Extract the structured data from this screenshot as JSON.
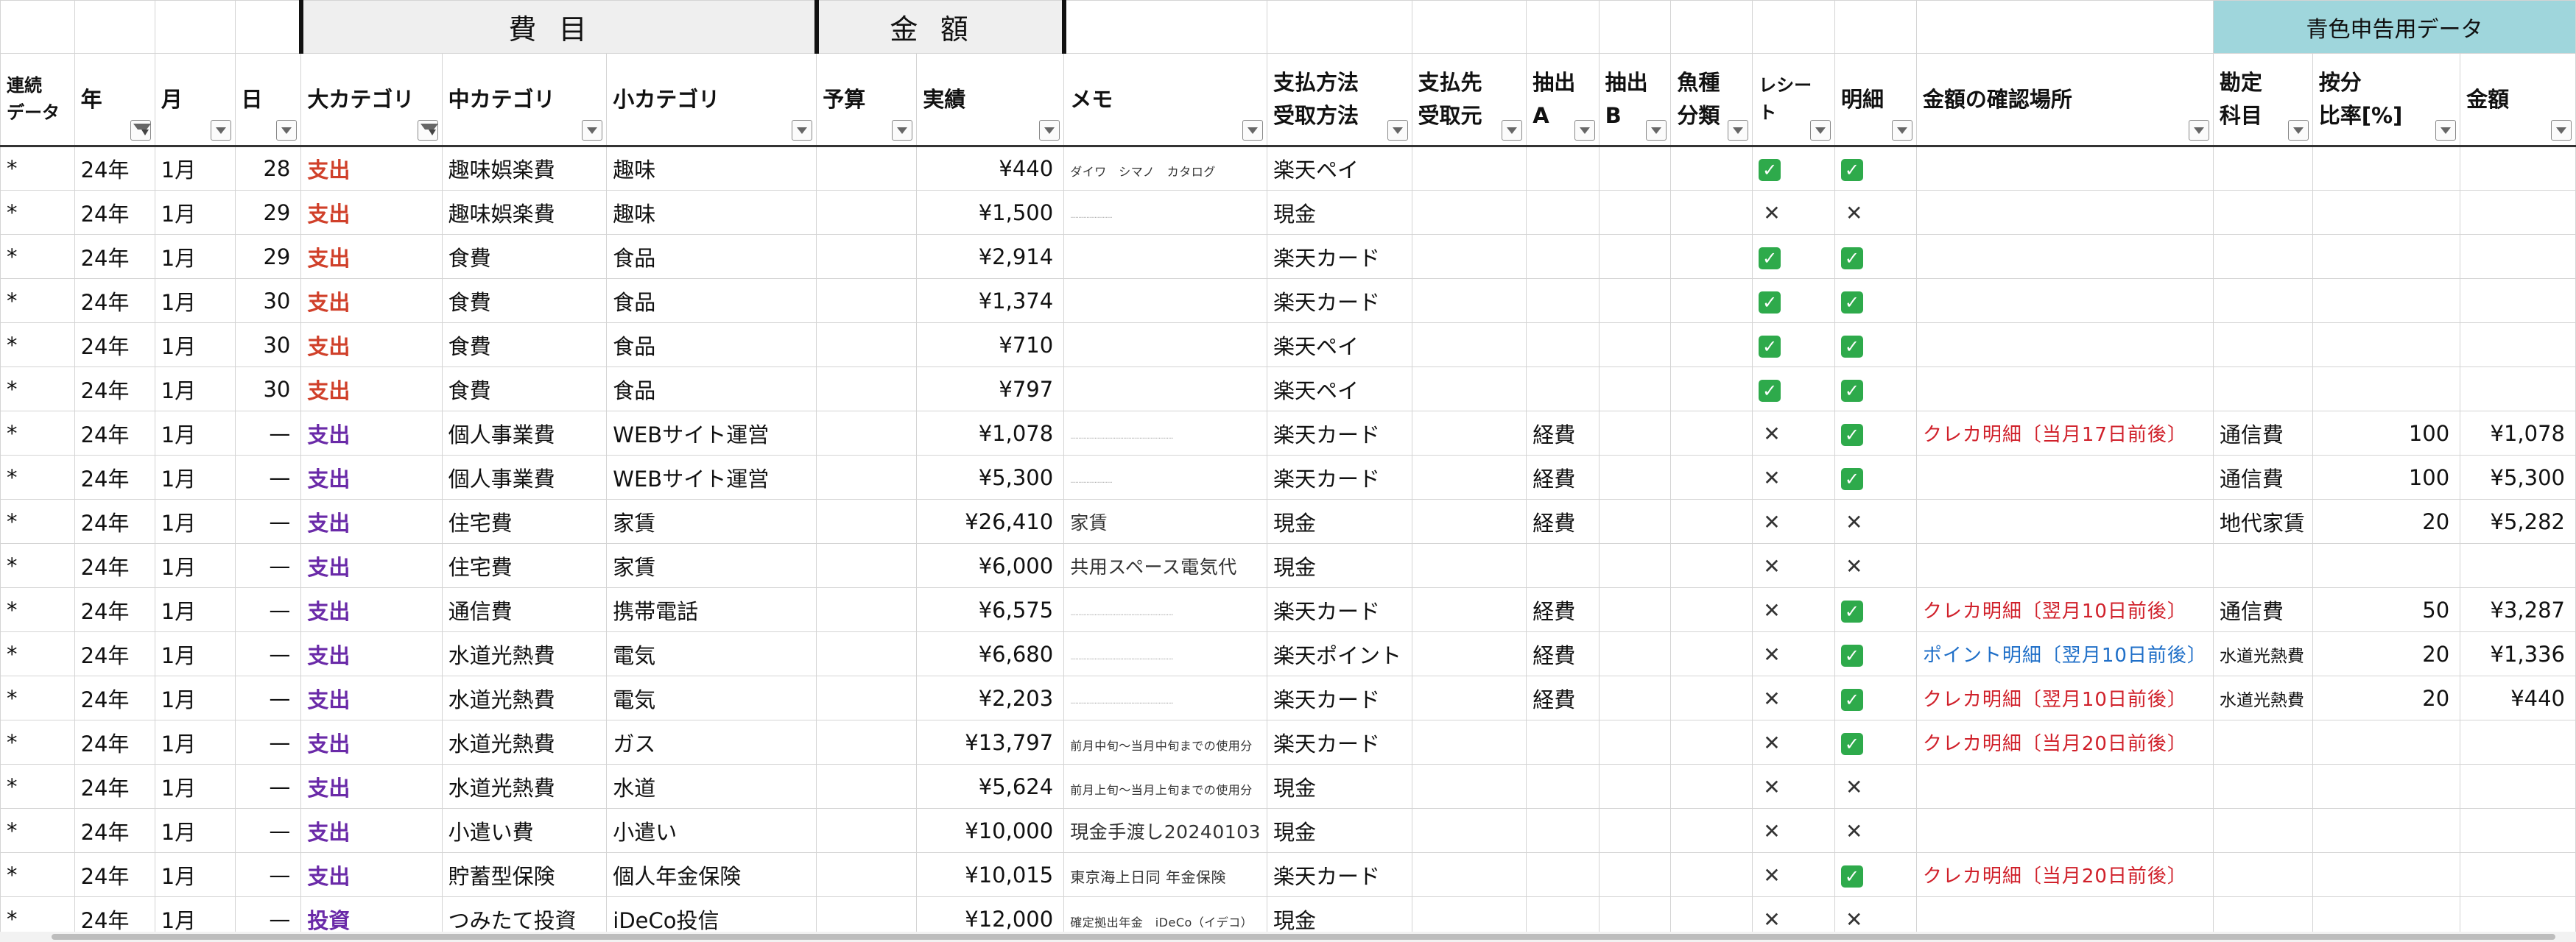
{
  "group_headers": {
    "cost_item": "費目",
    "amount": "金額",
    "blue_return": "青色申告用データ"
  },
  "columns": [
    {
      "label": "連続データ",
      "filter": false
    },
    {
      "label": "年",
      "filter": true,
      "active": true
    },
    {
      "label": "月",
      "filter": true
    },
    {
      "label": "日",
      "filter": true
    },
    {
      "label": "大カテゴリ",
      "filter": true,
      "active": true
    },
    {
      "label": "中カテゴリ",
      "filter": true
    },
    {
      "label": "小カテゴリ",
      "filter": true
    },
    {
      "label": "予算",
      "filter": true
    },
    {
      "label": "実績",
      "filter": true
    },
    {
      "label": "メモ",
      "filter": true
    },
    {
      "label": "支払方法受取方法",
      "filter": true
    },
    {
      "label": "支払先受取元",
      "filter": true
    },
    {
      "label": "抽出A",
      "filter": true
    },
    {
      "label": "抽出B",
      "filter": true
    },
    {
      "label": "魚種分類",
      "filter": true
    },
    {
      "label": "レシート",
      "filter": true
    },
    {
      "label": "明細",
      "filter": true
    },
    {
      "label": "金額の確認場所",
      "filter": true
    },
    {
      "label": "勘定科目",
      "filter": true
    },
    {
      "label": "按分比率[%]",
      "filter": true
    },
    {
      "label": "金額",
      "filter": true
    }
  ],
  "rows": [
    {
      "seq": "*",
      "year": "24年",
      "month": "1月",
      "day": "28",
      "major": "支出",
      "major_color": "red",
      "mid": "趣味娯楽費",
      "minor": "趣味",
      "budget": "",
      "actual": "¥440",
      "memo": "ダイワ　シマノ　カタログ",
      "memo_style": "small",
      "pay": "楽天ペイ",
      "payee": "",
      "ext_a": "",
      "ext_b": "",
      "fish": "",
      "receipt": "check",
      "detail": "check",
      "loc": "",
      "loc_color": "",
      "account": "",
      "ratio": "",
      "amount": ""
    },
    {
      "seq": "*",
      "year": "24年",
      "month": "1月",
      "day": "29",
      "major": "支出",
      "major_color": "red",
      "mid": "趣味娯楽費",
      "minor": "趣味",
      "budget": "",
      "actual": "¥1,500",
      "memo": "··························",
      "memo_style": "faint",
      "pay": "現金",
      "payee": "",
      "ext_a": "",
      "ext_b": "",
      "fish": "",
      "receipt": "cross",
      "detail": "cross",
      "loc": "",
      "loc_color": "",
      "account": "",
      "ratio": "",
      "amount": ""
    },
    {
      "seq": "*",
      "year": "24年",
      "month": "1月",
      "day": "29",
      "major": "支出",
      "major_color": "red",
      "mid": "食費",
      "minor": "食品",
      "budget": "",
      "actual": "¥2,914",
      "memo": "",
      "memo_style": "",
      "pay": "楽天カード",
      "payee": "",
      "ext_a": "",
      "ext_b": "",
      "fish": "",
      "receipt": "check",
      "detail": "check",
      "loc": "",
      "loc_color": "",
      "account": "",
      "ratio": "",
      "amount": ""
    },
    {
      "seq": "*",
      "year": "24年",
      "month": "1月",
      "day": "30",
      "major": "支出",
      "major_color": "red",
      "mid": "食費",
      "minor": "食品",
      "budget": "",
      "actual": "¥1,374",
      "memo": "",
      "memo_style": "",
      "pay": "楽天カード",
      "payee": "",
      "ext_a": "",
      "ext_b": "",
      "fish": "",
      "receipt": "check",
      "detail": "check",
      "loc": "",
      "loc_color": "",
      "account": "",
      "ratio": "",
      "amount": ""
    },
    {
      "seq": "*",
      "year": "24年",
      "month": "1月",
      "day": "30",
      "major": "支出",
      "major_color": "red",
      "mid": "食費",
      "minor": "食品",
      "budget": "",
      "actual": "¥710",
      "memo": "",
      "memo_style": "",
      "pay": "楽天ペイ",
      "payee": "",
      "ext_a": "",
      "ext_b": "",
      "fish": "",
      "receipt": "check",
      "detail": "check",
      "loc": "",
      "loc_color": "",
      "account": "",
      "ratio": "",
      "amount": ""
    },
    {
      "seq": "*",
      "year": "24年",
      "month": "1月",
      "day": "30",
      "major": "支出",
      "major_color": "red",
      "mid": "食費",
      "minor": "食品",
      "budget": "",
      "actual": "¥797",
      "memo": "",
      "memo_style": "",
      "pay": "楽天ペイ",
      "payee": "",
      "ext_a": "",
      "ext_b": "",
      "fish": "",
      "receipt": "check",
      "detail": "check",
      "loc": "",
      "loc_color": "",
      "account": "",
      "ratio": "",
      "amount": ""
    },
    {
      "seq": "*",
      "year": "24年",
      "month": "1月",
      "day": "—",
      "major": "支出",
      "major_color": "purple",
      "mid": "個人事業費",
      "minor": "WEBサイト運営",
      "budget": "",
      "actual": "¥1,078",
      "memo": "································································",
      "memo_style": "faint",
      "pay": "楽天カード",
      "payee": "",
      "ext_a": "経費",
      "ext_b": "",
      "fish": "",
      "receipt": "cross",
      "detail": "check",
      "loc": "クレカ明細〔当月17日前後〕",
      "loc_color": "red",
      "account": "通信費",
      "ratio": "100",
      "amount": "¥1,078"
    },
    {
      "seq": "*",
      "year": "24年",
      "month": "1月",
      "day": "—",
      "major": "支出",
      "major_color": "purple",
      "mid": "個人事業費",
      "minor": "WEBサイト運営",
      "budget": "",
      "actual": "¥5,300",
      "memo": "··························",
      "memo_style": "faint",
      "pay": "楽天カード",
      "payee": "",
      "ext_a": "経費",
      "ext_b": "",
      "fish": "",
      "receipt": "cross",
      "detail": "check",
      "loc": "",
      "loc_color": "",
      "account": "通信費",
      "ratio": "100",
      "amount": "¥5,300"
    },
    {
      "seq": "*",
      "year": "24年",
      "month": "1月",
      "day": "—",
      "major": "支出",
      "major_color": "purple",
      "mid": "住宅費",
      "minor": "家賃",
      "budget": "",
      "actual": "¥26,410",
      "memo": "家賃",
      "memo_style": "mid",
      "pay": "現金",
      "payee": "",
      "ext_a": "経費",
      "ext_b": "",
      "fish": "",
      "receipt": "cross",
      "detail": "cross",
      "loc": "",
      "loc_color": "",
      "account": "地代家賃",
      "ratio": "20",
      "amount": "¥5,282"
    },
    {
      "seq": "*",
      "year": "24年",
      "month": "1月",
      "day": "—",
      "major": "支出",
      "major_color": "purple",
      "mid": "住宅費",
      "minor": "家賃",
      "budget": "",
      "actual": "¥6,000",
      "memo": "共用スペース電気代",
      "memo_style": "mid",
      "pay": "現金",
      "payee": "",
      "ext_a": "",
      "ext_b": "",
      "fish": "",
      "receipt": "cross",
      "detail": "cross",
      "loc": "",
      "loc_color": "",
      "account": "",
      "ratio": "",
      "amount": ""
    },
    {
      "seq": "*",
      "year": "24年",
      "month": "1月",
      "day": "—",
      "major": "支出",
      "major_color": "purple",
      "mid": "通信費",
      "minor": "携帯電話",
      "budget": "",
      "actual": "¥6,575",
      "memo": "································································",
      "memo_style": "faint",
      "pay": "楽天カード",
      "payee": "",
      "ext_a": "経費",
      "ext_b": "",
      "fish": "",
      "receipt": "cross",
      "detail": "check",
      "loc": "クレカ明細〔翌月10日前後〕",
      "loc_color": "red",
      "account": "通信費",
      "ratio": "50",
      "amount": "¥3,287"
    },
    {
      "seq": "*",
      "year": "24年",
      "month": "1月",
      "day": "—",
      "major": "支出",
      "major_color": "purple",
      "mid": "水道光熱費",
      "minor": "電気",
      "budget": "",
      "actual": "¥6,680",
      "memo": "································································",
      "memo_style": "faint",
      "pay": "楽天ポイント",
      "payee": "",
      "ext_a": "経費",
      "ext_b": "",
      "fish": "",
      "receipt": "cross",
      "detail": "check",
      "loc": "ポイント明細〔翌月10日前後〕",
      "loc_color": "blue",
      "account": "水道光熱費",
      "ratio": "20",
      "amount": "¥1,336"
    },
    {
      "seq": "*",
      "year": "24年",
      "month": "1月",
      "day": "—",
      "major": "支出",
      "major_color": "purple",
      "mid": "水道光熱費",
      "minor": "電気",
      "budget": "",
      "actual": "¥2,203",
      "memo": "································································",
      "memo_style": "faint",
      "pay": "楽天カード",
      "payee": "",
      "ext_a": "経費",
      "ext_b": "",
      "fish": "",
      "receipt": "cross",
      "detail": "check",
      "loc": "クレカ明細〔翌月10日前後〕",
      "loc_color": "red",
      "account": "水道光熱費",
      "ratio": "20",
      "amount": "¥440"
    },
    {
      "seq": "*",
      "year": "24年",
      "month": "1月",
      "day": "—",
      "major": "支出",
      "major_color": "purple",
      "mid": "水道光熱費",
      "minor": "ガス",
      "budget": "",
      "actual": "¥13,797",
      "memo": "前月中旬～当月中旬までの使用分",
      "memo_style": "small",
      "pay": "楽天カード",
      "payee": "",
      "ext_a": "",
      "ext_b": "",
      "fish": "",
      "receipt": "cross",
      "detail": "check",
      "loc": "クレカ明細〔当月20日前後〕",
      "loc_color": "red",
      "account": "",
      "ratio": "",
      "amount": ""
    },
    {
      "seq": "*",
      "year": "24年",
      "month": "1月",
      "day": "—",
      "major": "支出",
      "major_color": "purple",
      "mid": "水道光熱費",
      "minor": "水道",
      "budget": "",
      "actual": "¥5,624",
      "memo": "前月上旬～当月上旬までの使用分",
      "memo_style": "small",
      "pay": "現金",
      "payee": "",
      "ext_a": "",
      "ext_b": "",
      "fish": "",
      "receipt": "cross",
      "detail": "cross",
      "loc": "",
      "loc_color": "",
      "account": "",
      "ratio": "",
      "amount": ""
    },
    {
      "seq": "*",
      "year": "24年",
      "month": "1月",
      "day": "—",
      "major": "支出",
      "major_color": "purple",
      "mid": "小遣い費",
      "minor": "小遣い",
      "budget": "",
      "actual": "¥10,000",
      "memo": "現金手渡し20240103",
      "memo_style": "mid",
      "pay": "現金",
      "payee": "",
      "ext_a": "",
      "ext_b": "",
      "fish": "",
      "receipt": "cross",
      "detail": "cross",
      "loc": "",
      "loc_color": "",
      "account": "",
      "ratio": "",
      "amount": ""
    },
    {
      "seq": "*",
      "year": "24年",
      "month": "1月",
      "day": "—",
      "major": "支出",
      "major_color": "purple",
      "mid": "貯蓄型保険",
      "minor": "個人年金保険",
      "budget": "",
      "actual": "¥10,015",
      "memo": "東京海上日同 年金保険",
      "memo_style": "smallmid",
      "pay": "楽天カード",
      "payee": "",
      "ext_a": "",
      "ext_b": "",
      "fish": "",
      "receipt": "cross",
      "detail": "check",
      "loc": "クレカ明細〔当月20日前後〕",
      "loc_color": "red",
      "account": "",
      "ratio": "",
      "amount": ""
    },
    {
      "seq": "*",
      "year": "24年",
      "month": "1月",
      "day": "—",
      "major": "投資",
      "major_color": "purple",
      "mid": "つみたて投資",
      "minor": "iDeCo投信",
      "budget": "",
      "actual": "¥12,000",
      "memo": "確定拠出年金　iDeCo（イデコ）",
      "memo_style": "small",
      "pay": "現金",
      "payee": "",
      "ext_a": "",
      "ext_b": "",
      "fish": "",
      "receipt": "cross",
      "detail": "cross",
      "loc": "",
      "loc_color": "",
      "account": "",
      "ratio": "",
      "amount": ""
    }
  ]
}
